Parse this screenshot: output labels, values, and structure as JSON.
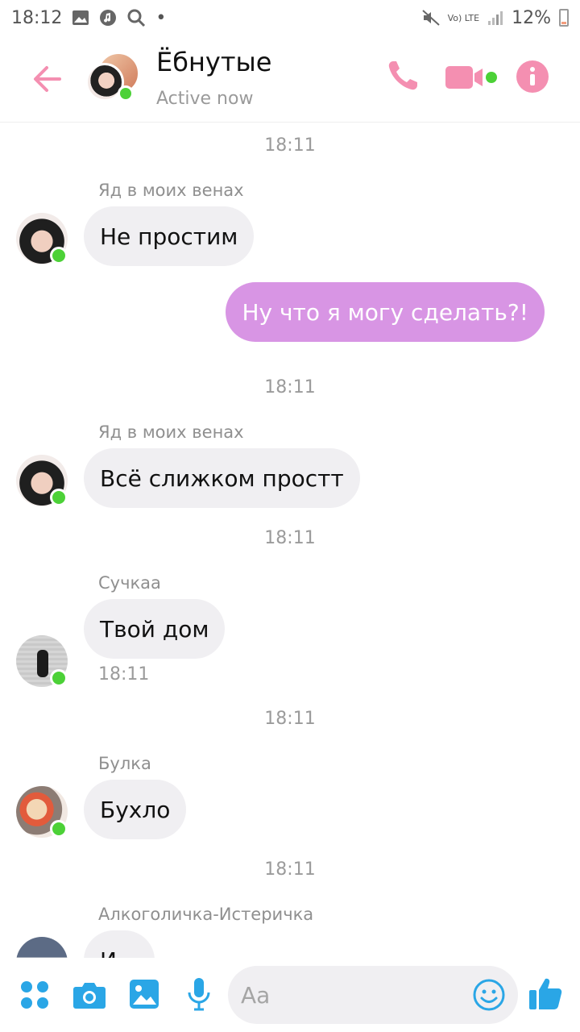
{
  "status_bar": {
    "time": "18:12",
    "lte_label": "Vo) LTE",
    "battery": "12%"
  },
  "header": {
    "title": "Ёбнутые",
    "subtitle": "Active now"
  },
  "messages": [
    {
      "time": "18:11"
    },
    {
      "sender": "Яд в моих венах",
      "text": "Не простим"
    },
    {
      "text": "Ну что я могу сделать?!",
      "outgoing": true
    },
    {
      "time": "18:11"
    },
    {
      "sender": "Яд в моих венах",
      "text": "Всё слижком простт"
    },
    {
      "time": "18:11"
    },
    {
      "sender": "Сучкаа",
      "text": "Твой дом",
      "read_time": "18:11"
    },
    {
      "time": "18:11"
    },
    {
      "sender": "Булка",
      "text": "Бухло"
    },
    {
      "time": "18:11"
    },
    {
      "sender": "Алкоголичка-Истеричка",
      "text": "И..."
    }
  ],
  "composer": {
    "placeholder": "Aa"
  },
  "colors": {
    "accent_pink": "#f48fb1",
    "outgoing_bubble": "#d895e4",
    "incoming_bubble": "#f0eff2",
    "composer_blue": "#2aa6e6",
    "online_green": "#4cd137"
  },
  "icons": [
    "back-arrow-icon",
    "phone-icon",
    "video-icon",
    "info-icon",
    "apps-icon",
    "camera-icon",
    "gallery-icon",
    "mic-icon",
    "emoji-icon",
    "like-icon"
  ]
}
